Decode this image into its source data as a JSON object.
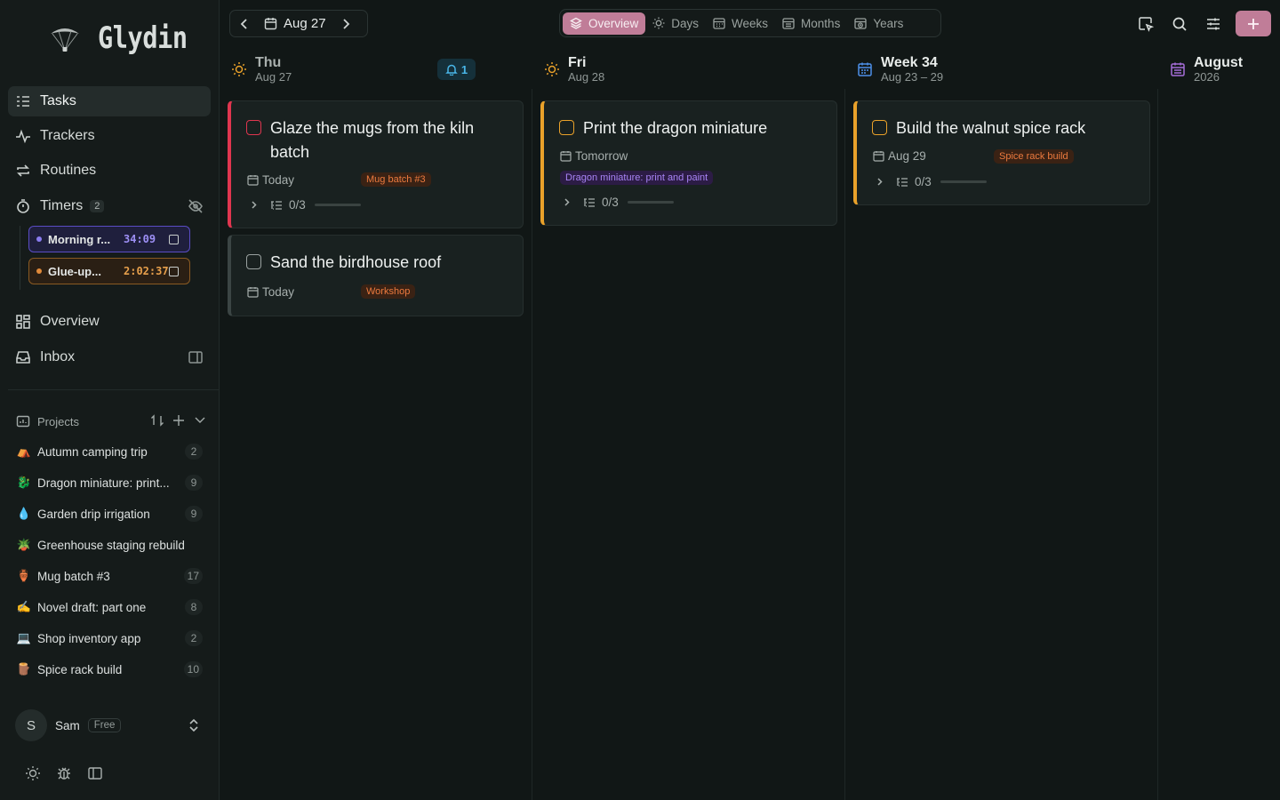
{
  "brand": {
    "name": "Glydin"
  },
  "nav": {
    "tasks": "Tasks",
    "trackers": "Trackers",
    "routines": "Routines",
    "timers": "Timers",
    "timers_count": "2",
    "overview": "Overview",
    "inbox": "Inbox"
  },
  "timers": [
    {
      "name": "Morning r...",
      "time": "34:09"
    },
    {
      "name": "Glue-up...",
      "time": "2:02:37"
    }
  ],
  "projects": {
    "title": "Projects",
    "items": [
      {
        "emoji": "⛺",
        "name": "Autumn camping trip",
        "count": "2"
      },
      {
        "emoji": "🐉",
        "name": "Dragon miniature: print...",
        "count": "9"
      },
      {
        "emoji": "💧",
        "name": "Garden drip irrigation",
        "count": "9"
      },
      {
        "emoji": "🪴",
        "name": "Greenhouse staging rebuild",
        "count": ""
      },
      {
        "emoji": "🏺",
        "name": "Mug batch #3",
        "count": "17"
      },
      {
        "emoji": "✍️",
        "name": "Novel draft: part one",
        "count": "8"
      },
      {
        "emoji": "💻",
        "name": "Shop inventory app",
        "count": "2"
      },
      {
        "emoji": "🪵",
        "name": "Spice rack build",
        "count": "10"
      }
    ]
  },
  "user": {
    "initial": "S",
    "name": "Sam",
    "plan": "Free"
  },
  "topbar": {
    "date": "Aug 27",
    "tabs": [
      "Overview",
      "Days",
      "Weeks",
      "Months",
      "Years"
    ]
  },
  "columns": {
    "thu": {
      "title": "Thu",
      "sub": "Aug 27",
      "notifications": "1"
    },
    "fri": {
      "title": "Fri",
      "sub": "Aug 28"
    },
    "week": {
      "title": "Week 34",
      "sub": "Aug 23 – 29"
    },
    "month": {
      "title": "August",
      "sub": "2026"
    }
  },
  "cards": {
    "glaze": {
      "title": "Glaze the mugs from the kiln batch",
      "date": "Today",
      "tag": "Mug batch #3",
      "progress": "0/3"
    },
    "sand": {
      "title": "Sand the birdhouse roof",
      "date": "Today",
      "tag": "Workshop"
    },
    "dragon": {
      "title": "Print the dragon miniature",
      "date": "Tomorrow",
      "tag": "Dragon miniature: print and paint",
      "progress": "0/3"
    },
    "walnut": {
      "title": "Build the walnut spice rack",
      "date": "Aug 29",
      "tag": "Spice rack build",
      "progress": "0/3"
    }
  },
  "colors": {
    "accent": "#c07d98",
    "priority_high": "#e0364f",
    "priority_medium": "#e9a12a",
    "tag_orange": "#ec7a3e",
    "tag_violet": "#a884f5"
  }
}
